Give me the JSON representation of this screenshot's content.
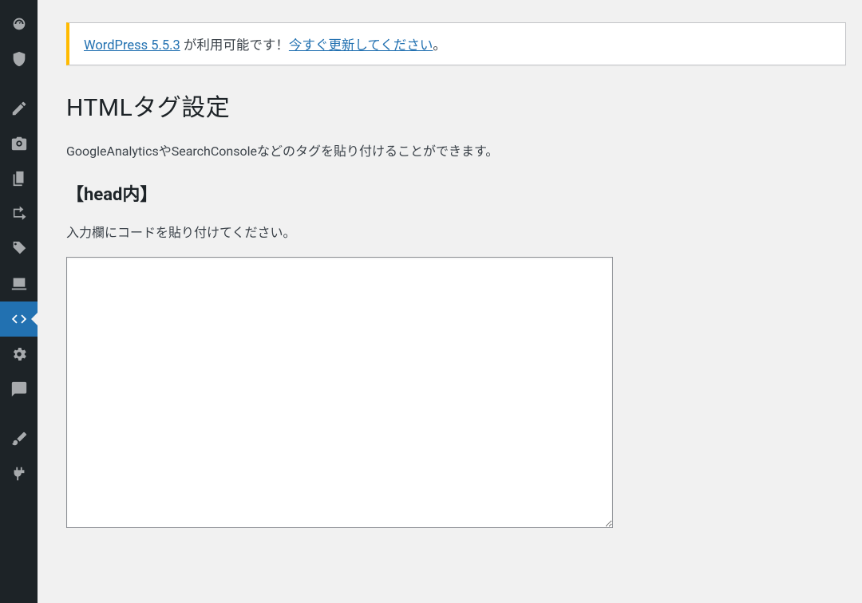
{
  "notice": {
    "link1": "WordPress 5.5.3",
    "mid": " が利用可能です！",
    "link2": "今すぐ更新してください",
    "suffix": "。"
  },
  "page_title": "HTMLタグ設定",
  "description": "GoogleAnalyticsやSearchConsoleなどのタグを貼り付けることができます。",
  "section_head": "【head内】",
  "instruction": "入力欄にコードを貼り付けてください。",
  "textarea_value": "",
  "sidebar_icons": [
    "dashboard-icon",
    "shield-icon",
    "pencil-icon",
    "camera-icon",
    "pages-icon",
    "share-icon",
    "tag-icon",
    "user-icon",
    "code-icon",
    "gear-icon",
    "comment-icon",
    "brush-icon",
    "plugin-icon"
  ]
}
